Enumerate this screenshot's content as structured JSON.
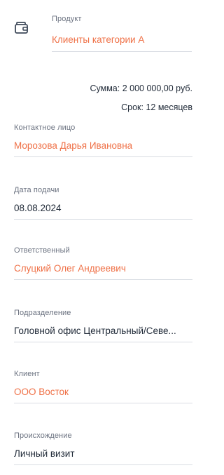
{
  "product": {
    "icon": "wallet-icon",
    "label": "Продукт",
    "value": "Клиенты категории А"
  },
  "summary": {
    "sum_text": "Сумма: 2 000 000,00 руб.",
    "term_text": "Срок: 12 месяцев"
  },
  "fields": {
    "contact": {
      "label": "Контактное лицо",
      "value": "Морозова Дарья Ивановна"
    },
    "submit_date": {
      "label": "Дата подачи",
      "value": "08.08.2024"
    },
    "responsible": {
      "label": "Ответственный",
      "value": "Слуцкий Олег Андреевич"
    },
    "department": {
      "label": "Подразделение",
      "value": "Головной офис Центральный/Севе..."
    },
    "client": {
      "label": "Клиент",
      "value": "ООО Восток"
    },
    "origin": {
      "label": "Происхождение",
      "value": "Личный визит"
    }
  },
  "colors": {
    "link": "#ef7046",
    "text": "#1f2937",
    "label": "#6b7280",
    "divider": "#d9dde3"
  }
}
